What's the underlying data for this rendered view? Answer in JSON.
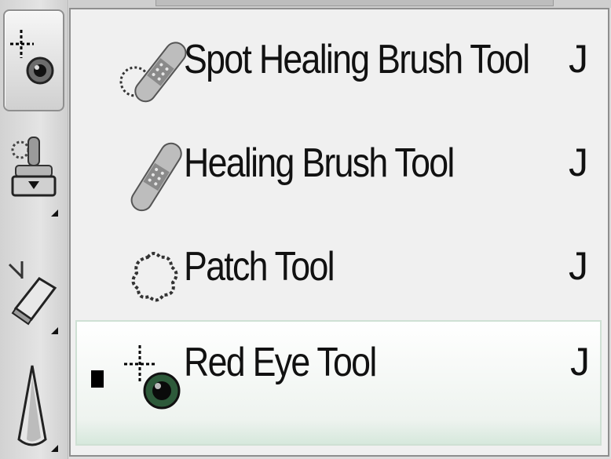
{
  "toolbar": {
    "tools": [
      {
        "name": "red-eye-tool",
        "selected": true
      },
      {
        "name": "clone-stamp-tool",
        "selected": false
      },
      {
        "name": "eraser-tool",
        "selected": false
      },
      {
        "name": "blur-tool",
        "selected": false
      }
    ]
  },
  "menu": {
    "items": [
      {
        "label": "Spot Healing Brush Tool",
        "shortcut": "J",
        "icon": "spot-healing-brush-icon",
        "active": false
      },
      {
        "label": "Healing Brush Tool",
        "shortcut": "J",
        "icon": "healing-brush-icon",
        "active": false
      },
      {
        "label": "Patch Tool",
        "shortcut": "J",
        "icon": "patch-icon",
        "active": false
      },
      {
        "label": "Red Eye Tool",
        "shortcut": "J",
        "icon": "red-eye-icon",
        "active": true
      }
    ]
  },
  "colors": {
    "menu_bg": "#f0f0f0",
    "highlight_bg": "#eef3ef",
    "text": "#111111"
  }
}
